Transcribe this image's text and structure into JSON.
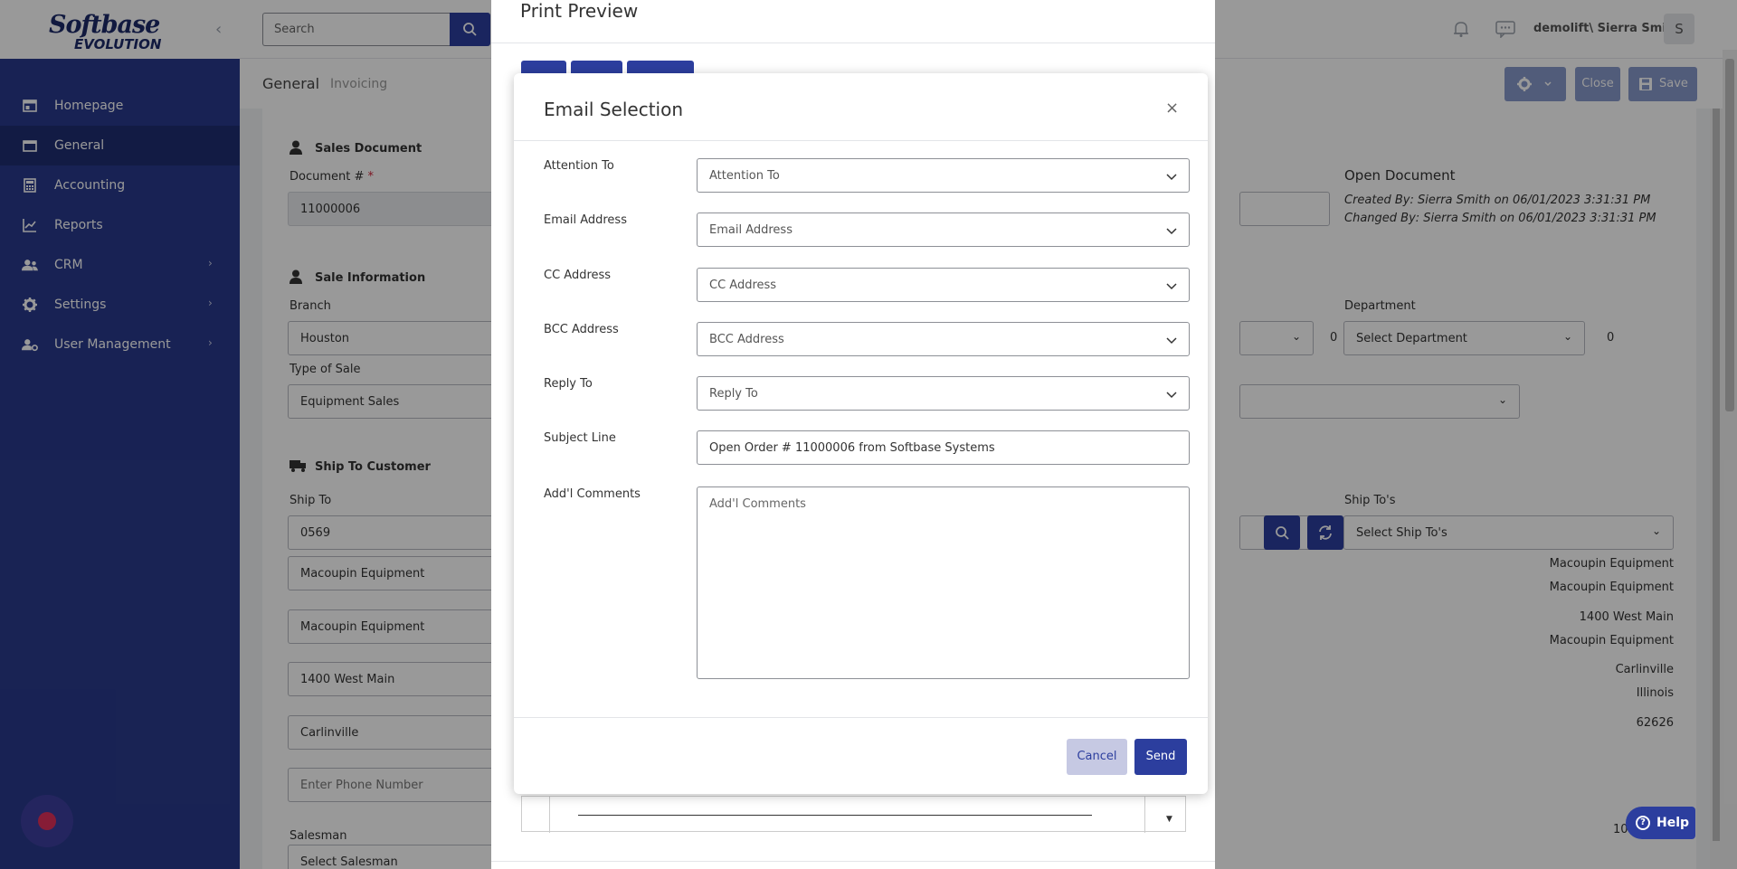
{
  "sidebar": {
    "logo_line1": "Softbase",
    "logo_line2": "EVOLUTION",
    "collapse": "‹",
    "items": [
      {
        "label": "Homepage",
        "icon": "home-icon"
      },
      {
        "label": "General",
        "icon": "folder-icon",
        "active": true
      },
      {
        "label": "Accounting",
        "icon": "calculator-icon"
      },
      {
        "label": "Reports",
        "icon": "chart-icon"
      },
      {
        "label": "CRM",
        "icon": "users-icon",
        "chevron": "›"
      },
      {
        "label": "Settings",
        "icon": "gear-icon",
        "chevron": "›"
      },
      {
        "label": "User Management",
        "icon": "user-cog-icon",
        "chevron": "›"
      }
    ]
  },
  "header": {
    "search_placeholder": "Search",
    "user_name": "demolift\\ Sierra Smith",
    "avatar_letter": "S"
  },
  "subheader": {
    "tab_general": "General",
    "tab_invoicing": "Invoicing",
    "close_label": "Close",
    "save_label": "Save"
  },
  "form": {
    "sales_document_title": "Sales Document",
    "document_label": "Document #",
    "required_mark": "*",
    "document_value": "11000006",
    "open_document_title": "Open Document",
    "created_by": "Created By: Sierra Smith on 06/01/2023 3:31:31 PM",
    "changed_by": "Changed By: Sierra Smith on 06/01/2023 3:31:31 PM",
    "sale_information_title": "Sale Information",
    "branch_label": "Branch",
    "branch_value": "Houston",
    "department_label": "Department",
    "department_placeholder": "Select Department",
    "dept_count": "0",
    "mid_count": "0",
    "type_of_sale_label": "Type of Sale",
    "type_of_sale_value": "Equipment Sales",
    "ship_to_customer_title": "Ship To Customer",
    "ship_to_label": "Ship To",
    "ship_to_value": "0569",
    "ship_tos_label": "Ship To's",
    "ship_tos_placeholder": "Select Ship To's",
    "addr_name1": "Macoupin Equipment",
    "addr_name2": "Macoupin Equipment",
    "addr_street": "1400 West Main",
    "addr_city": "Carlinville",
    "phone_placeholder": "Enter Phone Number",
    "salesman_label": "Salesman",
    "salesman_placeholder": "Select Salesman",
    "right_name1": "Macoupin Equipment",
    "right_name2": "Macoupin Equipment",
    "right_street": "1400 West Main",
    "right_name3": "Macoupin Equipment",
    "right_city": "Carlinville",
    "right_state": "Illinois",
    "right_zip": "62626",
    "right_partial": "10"
  },
  "print_preview": {
    "title": "Print Preview"
  },
  "email_selection": {
    "title": "Email Selection",
    "close_icon": "×",
    "attention_label": "Attention To",
    "attention_placeholder": "Attention To",
    "email_label": "Email Address",
    "email_placeholder": "Email Address",
    "cc_label": "CC Address",
    "cc_placeholder": "CC Address",
    "bcc_label": "BCC Address",
    "bcc_placeholder": "BCC Address",
    "reply_label": "Reply To",
    "reply_placeholder": "Reply To",
    "subject_label": "Subject Line",
    "subject_value": "Open Order # 11000006 from Softbase Systems",
    "comments_label": "Add'l Comments",
    "comments_placeholder": "Add'l Comments",
    "cancel_label": "Cancel",
    "send_label": "Send"
  },
  "help": {
    "label": "Help"
  },
  "colors": {
    "sidebar": "#293a8c",
    "primary": "#2c3e9e",
    "cancel_bg": "#c6c9e3"
  }
}
